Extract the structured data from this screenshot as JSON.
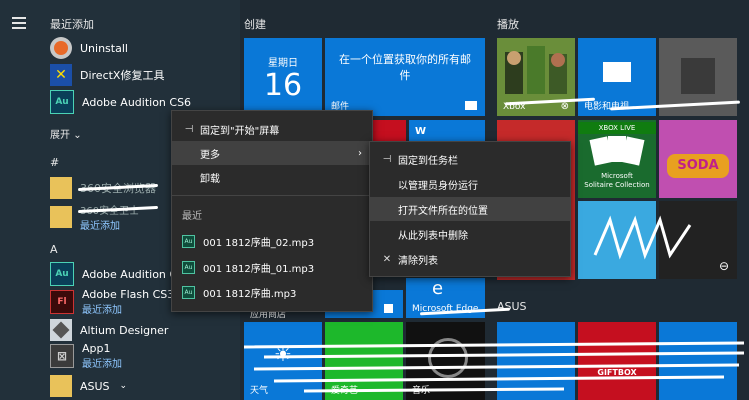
{
  "left_pane": {
    "recently_added_header": "最近添加",
    "recent_apps": [
      {
        "label": "Uninstall"
      },
      {
        "label": "DirectX修复工具"
      },
      {
        "label": "Adobe Audition CS6"
      }
    ],
    "expand_label": "展开",
    "hash_header": "#",
    "hash_apps": [
      {
        "label": "360安全浏览器",
        "sub": ""
      },
      {
        "label": "360安全卫士",
        "sub": "最近添加"
      }
    ],
    "a_header": "A",
    "a_apps": [
      {
        "label": "Adobe Audition CS6",
        "sub": ""
      },
      {
        "label": "Adobe Flash CS3 Pro",
        "sub": "最近添加"
      },
      {
        "label": "Altium Designer",
        "sub": ""
      },
      {
        "label": "App1",
        "sub": "最近添加"
      },
      {
        "label": "ASUS",
        "sub": ""
      }
    ]
  },
  "tiles": {
    "create_header": "创建",
    "play_header": "播放",
    "asus_header": "ASUS",
    "calendar": {
      "day": "星期日",
      "date": "16"
    },
    "mail": {
      "text": "在一个位置获取你的所有邮件",
      "label": "邮件"
    },
    "xbox": {
      "label": "Xbox"
    },
    "movies": {
      "label": "电影和电视"
    },
    "solitaire": {
      "badge": "XBOX LIVE",
      "line1": "Microsoft",
      "line2": "Solitaire Collection"
    },
    "candy": {
      "text": "SODA"
    },
    "app_store": {
      "label": "应用商店"
    },
    "edge": {
      "label": "Microsoft Edge"
    },
    "weather": {
      "label": "天气"
    },
    "iqiyi": {
      "label": "爱奇艺"
    },
    "music": {
      "label": "音乐"
    },
    "asus_gift": {
      "text": "GIFTBOX"
    }
  },
  "context_menu": {
    "items": [
      {
        "icon": "⊣",
        "label": "固定到\"开始\"屏幕"
      },
      {
        "icon": "",
        "label": "更多"
      },
      {
        "icon": "",
        "label": "卸载"
      }
    ],
    "recent_header": "最近",
    "recent_files": [
      {
        "label": "001 1812序曲_02.mp3"
      },
      {
        "label": "001 1812序曲_01.mp3"
      },
      {
        "label": "001 1812序曲.mp3"
      }
    ]
  },
  "submenu": {
    "items": [
      {
        "icon": "⊣",
        "label": "固定到任务栏"
      },
      {
        "icon": "",
        "label": "以管理员身份运行"
      },
      {
        "icon": "",
        "label": "打开文件所在的位置"
      },
      {
        "icon": "",
        "label": "从此列表中删除"
      },
      {
        "icon": "✕",
        "label": "清除列表"
      }
    ]
  },
  "colors": {
    "accent": "#0a78d7",
    "menu_bg": "#2b2b2b",
    "green": "#1db82b",
    "red": "#c50f1f"
  }
}
